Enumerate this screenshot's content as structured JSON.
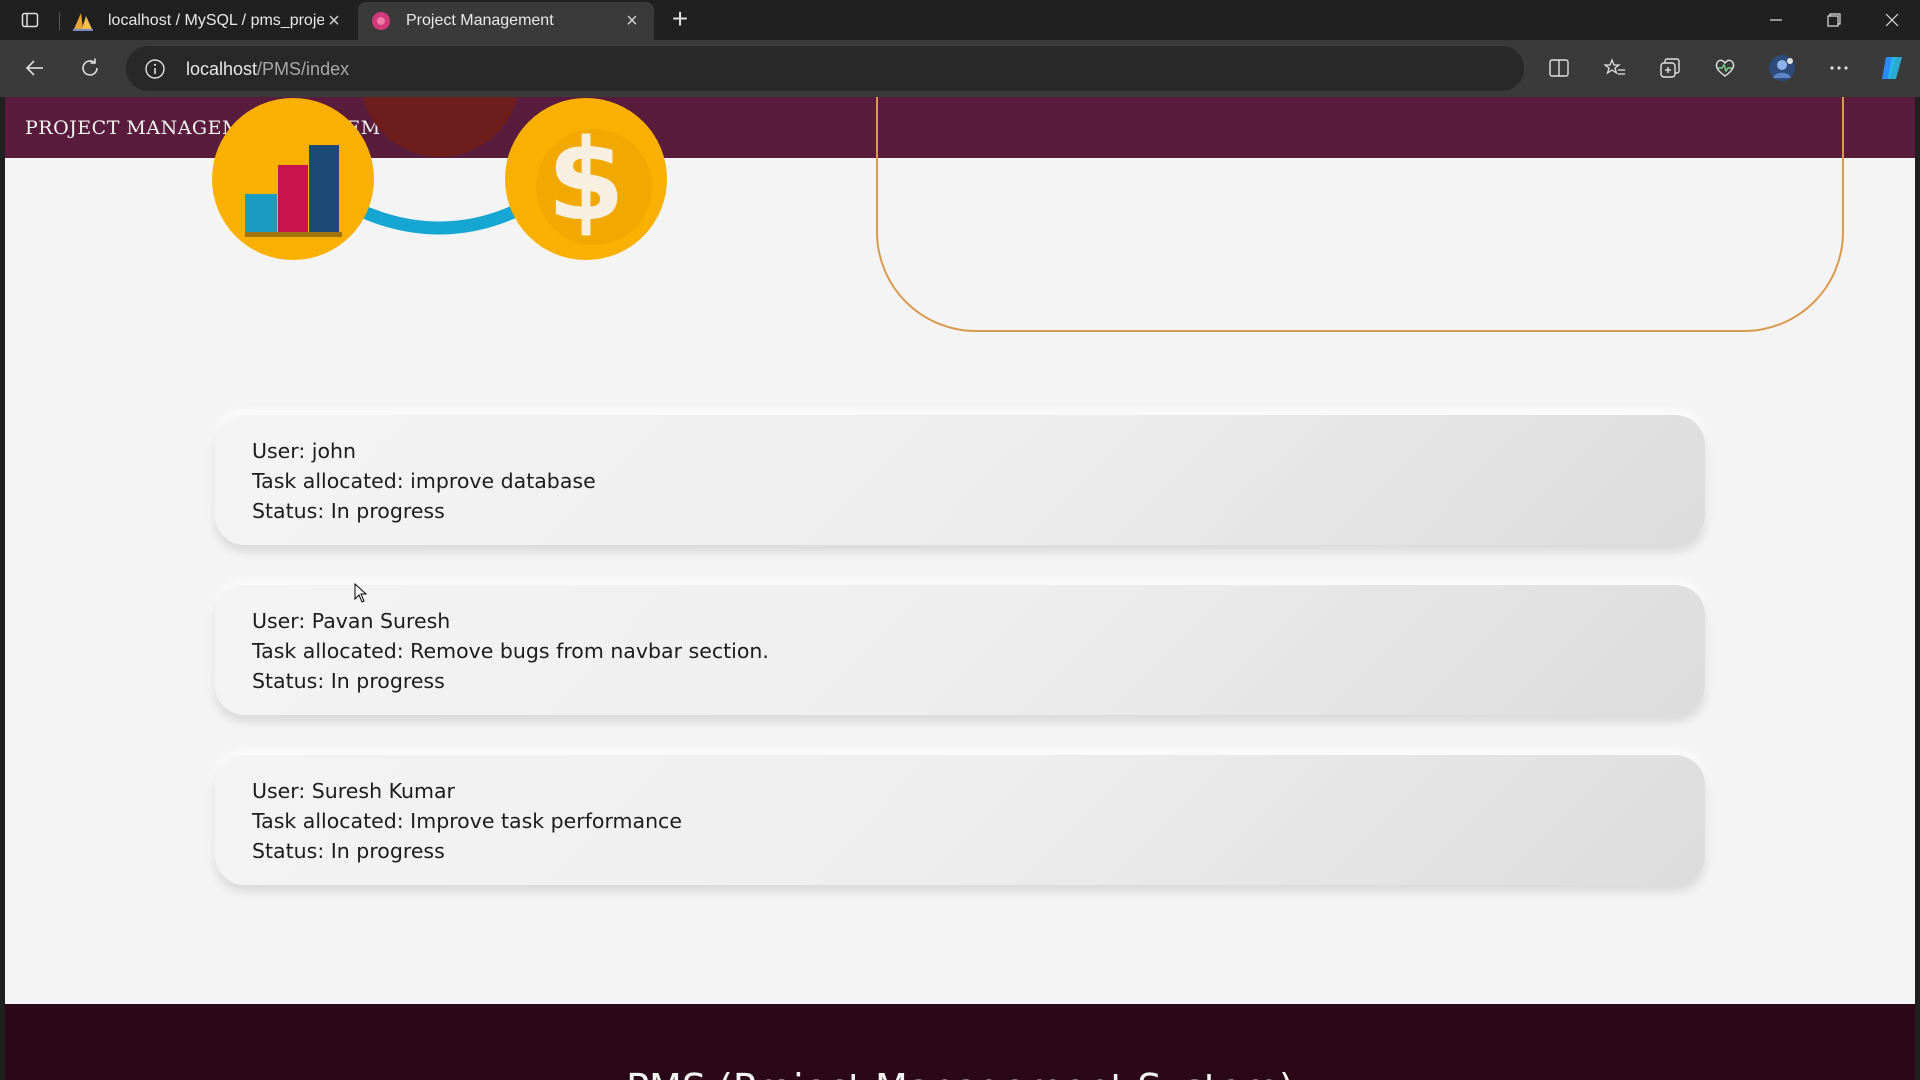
{
  "browser": {
    "tabs": [
      {
        "title": "localhost / MySQL / pms_project",
        "favicon": "phpmyadmin-sail-icon",
        "active": false
      },
      {
        "title": "Project Management",
        "favicon": "pink-circle-icon",
        "active": true
      }
    ],
    "url_host": "localhost",
    "url_path": "/PMS/index"
  },
  "page": {
    "brand": "PROJECT MANAGEMENT SYSTEM",
    "tasks": [
      {
        "user": "User: john",
        "task": "Task allocated: improve database",
        "status": "Status: In progress"
      },
      {
        "user": "User: Pavan Suresh",
        "task": "Task allocated: Remove bugs from navbar section.",
        "status": "Status: In progress"
      },
      {
        "user": "User: Suresh Kumar",
        "task": "Task allocated: Improve task performance",
        "status": "Status: In progress"
      }
    ],
    "footer_title": "PMS (Project Management System)"
  },
  "colors": {
    "navbar": "#5a1c3d",
    "footer": "#2a0818",
    "accent_gold": "#f9b000",
    "outline": "#d99a4e"
  }
}
